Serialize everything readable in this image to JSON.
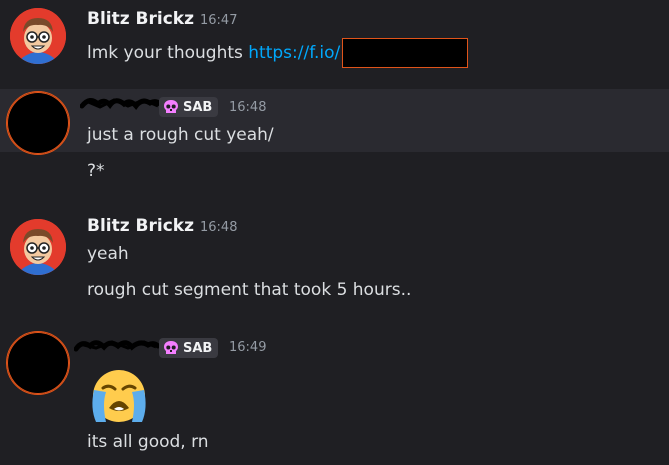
{
  "messages": [
    {
      "author": "Blitz Brickz",
      "timestamp": "16:47",
      "lines": [
        {
          "text": "lmk your thoughts ",
          "link": "https://f.io/"
        }
      ]
    },
    {
      "author": "",
      "role_tag": "SAB",
      "timestamp": "16:48",
      "lines": [
        "just a rough cut yeah/",
        "?*"
      ]
    },
    {
      "author": "Blitz Brickz",
      "timestamp": "16:48",
      "lines": [
        "yeah",
        "rough cut segment that took 5 hours.."
      ]
    },
    {
      "author": "",
      "role_tag": "SAB",
      "timestamp": "16:49",
      "emoji": "loudly-crying-face-emoji",
      "lines": [
        "its all good, rn"
      ]
    }
  ],
  "colors": {
    "background": "#1f1f23",
    "link": "#00a8fc",
    "redaction_border": "#e0541a",
    "tag_icon": "#f47fff",
    "avatar_background": "#e33b2c"
  }
}
